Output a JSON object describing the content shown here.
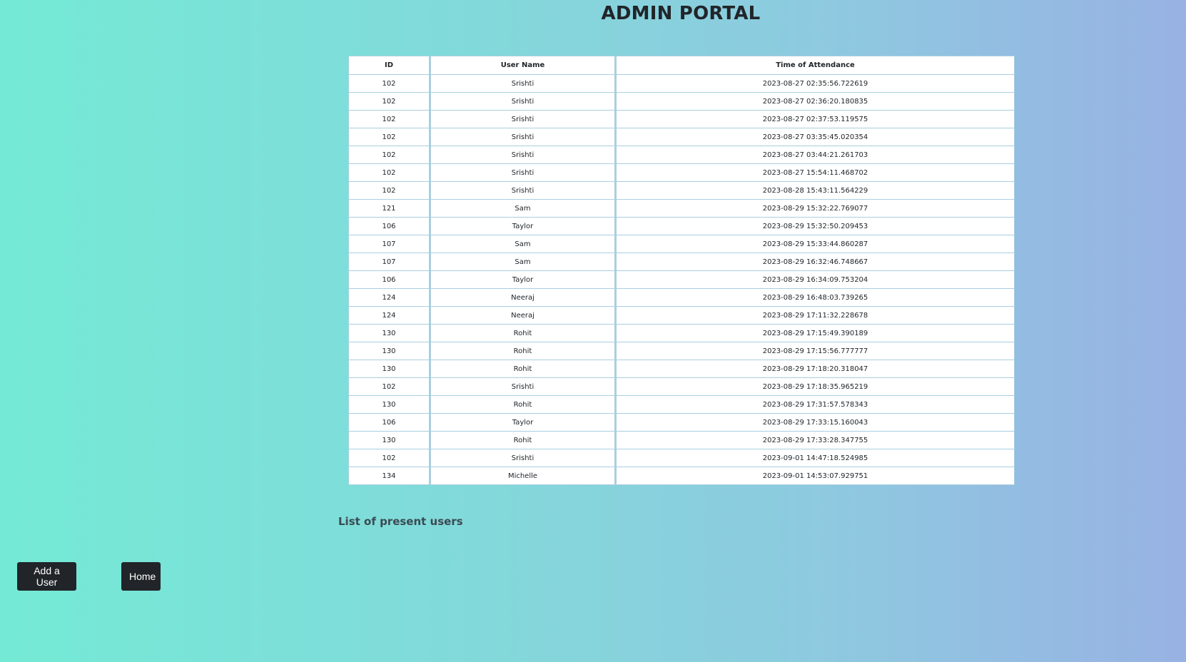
{
  "header": {
    "title": "ADMIN PORTAL"
  },
  "table": {
    "columns": [
      "ID",
      "User Name",
      "Time of Attendance"
    ],
    "rows": [
      [
        "102",
        "Srishti",
        "2023-08-27 02:35:56.722619"
      ],
      [
        "102",
        "Srishti",
        "2023-08-27 02:36:20.180835"
      ],
      [
        "102",
        "Srishti",
        "2023-08-27 02:37:53.119575"
      ],
      [
        "102",
        "Srishti",
        "2023-08-27 03:35:45.020354"
      ],
      [
        "102",
        "Srishti",
        "2023-08-27 03:44:21.261703"
      ],
      [
        "102",
        "Srishti",
        "2023-08-27 15:54:11.468702"
      ],
      [
        "102",
        "Srishti",
        "2023-08-28 15:43:11.564229"
      ],
      [
        "121",
        "Sam",
        "2023-08-29 15:32:22.769077"
      ],
      [
        "106",
        "Taylor",
        "2023-08-29 15:32:50.209453"
      ],
      [
        "107",
        "Sam",
        "2023-08-29 15:33:44.860287"
      ],
      [
        "107",
        "Sam",
        "2023-08-29 16:32:46.748667"
      ],
      [
        "106",
        "Taylor",
        "2023-08-29 16:34:09.753204"
      ],
      [
        "124",
        "Neeraj",
        "2023-08-29 16:48:03.739265"
      ],
      [
        "124",
        "Neeraj",
        "2023-08-29 17:11:32.228678"
      ],
      [
        "130",
        "Rohit",
        "2023-08-29 17:15:49.390189"
      ],
      [
        "130",
        "Rohit",
        "2023-08-29 17:15:56.777777"
      ],
      [
        "130",
        "Rohit",
        "2023-08-29 17:18:20.318047"
      ],
      [
        "102",
        "Srishti",
        "2023-08-29 17:18:35.965219"
      ],
      [
        "130",
        "Rohit",
        "2023-08-29 17:31:57.578343"
      ],
      [
        "106",
        "Taylor",
        "2023-08-29 17:33:15.160043"
      ],
      [
        "130",
        "Rohit",
        "2023-08-29 17:33:28.347755"
      ],
      [
        "102",
        "Srishti",
        "2023-09-01 14:47:18.524985"
      ],
      [
        "134",
        "Michelle",
        "2023-09-01 14:53:07.929751"
      ]
    ]
  },
  "caption": "List of present users",
  "buttons": {
    "add_user": "Add a User",
    "home": "Home"
  },
  "colors": {
    "button_bg": "#212529",
    "gradient_start": "#74ead6",
    "gradient_end": "#98b2e3"
  }
}
